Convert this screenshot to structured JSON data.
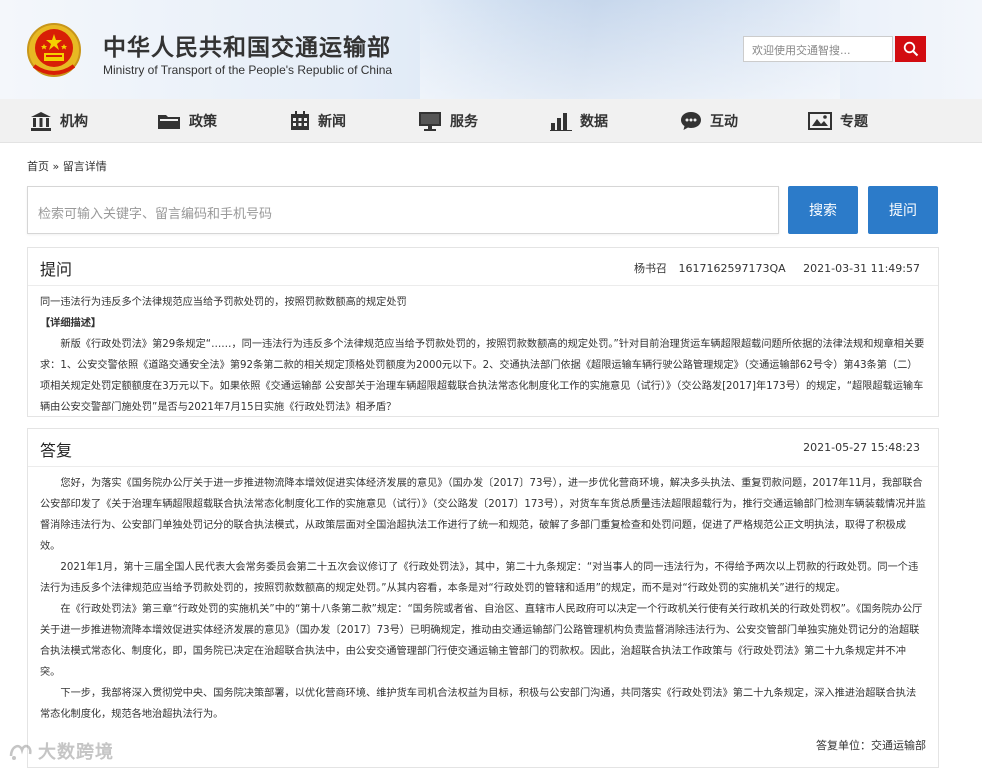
{
  "header": {
    "title_cn": "中华人民共和国交通运输部",
    "title_en": "Ministry of Transport of the People's Republic of China",
    "search_placeholder": "欢迎使用交通智搜...",
    "accent_color": "#d20c11"
  },
  "nav": {
    "items": [
      {
        "label": "机构",
        "icon": "building-icon"
      },
      {
        "label": "政策",
        "icon": "folder-icon"
      },
      {
        "label": "新闻",
        "icon": "calendar-icon"
      },
      {
        "label": "服务",
        "icon": "monitor-icon"
      },
      {
        "label": "数据",
        "icon": "bar-chart-icon"
      },
      {
        "label": "互动",
        "icon": "chat-icon"
      },
      {
        "label": "专题",
        "icon": "image-icon"
      }
    ]
  },
  "breadcrumb": {
    "home": "首页",
    "separator": "»",
    "current": "留言详情"
  },
  "search": {
    "placeholder": "检索可输入关键字、留言编码和手机号码",
    "search_button": "搜索",
    "ask_button": "提问",
    "button_color": "#2c7bc9"
  },
  "question": {
    "heading": "提问",
    "author": "杨书召",
    "code": "1617162597173QA",
    "datetime": "2021-03-31 11:49:57",
    "summary": "同一违法行为违反多个法律规范应当给予罚款处罚的，按照罚款数额高的规定处罚",
    "detail_label": "【详细描述】",
    "detail": "新版《行政处罚法》第29条规定“……，同一违法行为违反多个法律规范应当给予罚款处罚的，按照罚款数额高的规定处罚。”针对目前治理货运车辆超限超载问题所依据的法律法规和规章相关要求：1、公安交警依照《道路交通安全法》第92条第二款的相关规定顶格处罚额度为2000元以下。2、交通执法部门依据《超限运输车辆行驶公路管理规定》（交通运输部62号令）第43条第（二）项相关规定处罚定额额度在3万元以下。如果依照《交通运输部 公安部关于治理车辆超限超载联合执法常态化制度化工作的实施意见（试行）》（交公路发[2017]年173号）的规定，“超限超载运输车辆由公安交警部门施处罚”是否与2021年7月15日实施《行政处罚法》相矛盾？"
  },
  "answer": {
    "heading": "答复",
    "datetime": "2021-05-27 15:48:23",
    "paragraphs": [
      "您好，为落实《国务院办公厅关于进一步推进物流降本增效促进实体经济发展的意见》（国办发〔2017〕73号），进一步优化营商环境，解决多头执法、重复罚款问题，2017年11月，我部联合公安部印发了《关于治理车辆超限超载联合执法常态化制度化工作的实施意见（试行）》（交公路发〔2017〕173号），对货车车货总质量违法超限超载行为，推行交通运输部门检测车辆装载情况并监督消除违法行为、公安部门单独处罚记分的联合执法模式，从政策层面对全国治超执法工作进行了统一和规范，破解了多部门重复检查和处罚问题，促进了严格规范公正文明执法，取得了积极成效。",
      "2021年1月，第十三届全国人民代表大会常务委员会第二十五次会议修订了《行政处罚法》，其中，第二十九条规定：“对当事人的同一违法行为，不得给予两次以上罚款的行政处罚。同一个违法行为违反多个法律规范应当给予罚款处罚的，按照罚款数额高的规定处罚。”从其内容看，本条是对“行政处罚的管辖和适用”的规定，而不是对“行政处罚的实施机关”进行的规定。",
      "在《行政处罚法》第三章“行政处罚的实施机关”中的“第十八条第二款”规定：“国务院或者省、自治区、直辖市人民政府可以决定一个行政机关行使有关行政机关的行政处罚权”。《国务院办公厅关于进一步推进物流降本增效促进实体经济发展的意见》（国办发〔2017〕73号）已明确规定，推动由交通运输部门公路管理机构负责监督消除违法行为、公安交管部门单独实施处罚记分的治超联合执法模式常态化、制度化，即，国务院已决定在治超联合执法中，由公安交通管理部门行使交通运输主管部门的罚款权。因此，治超联合执法工作政策与《行政处罚法》第二十九条规定并不冲突。",
      "下一步，我部将深入贯彻党中央、国务院决策部署，以优化营商环境、维护货车司机合法权益为目标，积极与公安部门沟通，共同落实《行政处罚法》第二十九条规定，深入推进治超联合执法常态化制度化，规范各地治超执法行为。"
    ],
    "unit_label": "答复单位：",
    "unit": "交通运输部"
  },
  "watermark": {
    "text": "大数跨境"
  }
}
